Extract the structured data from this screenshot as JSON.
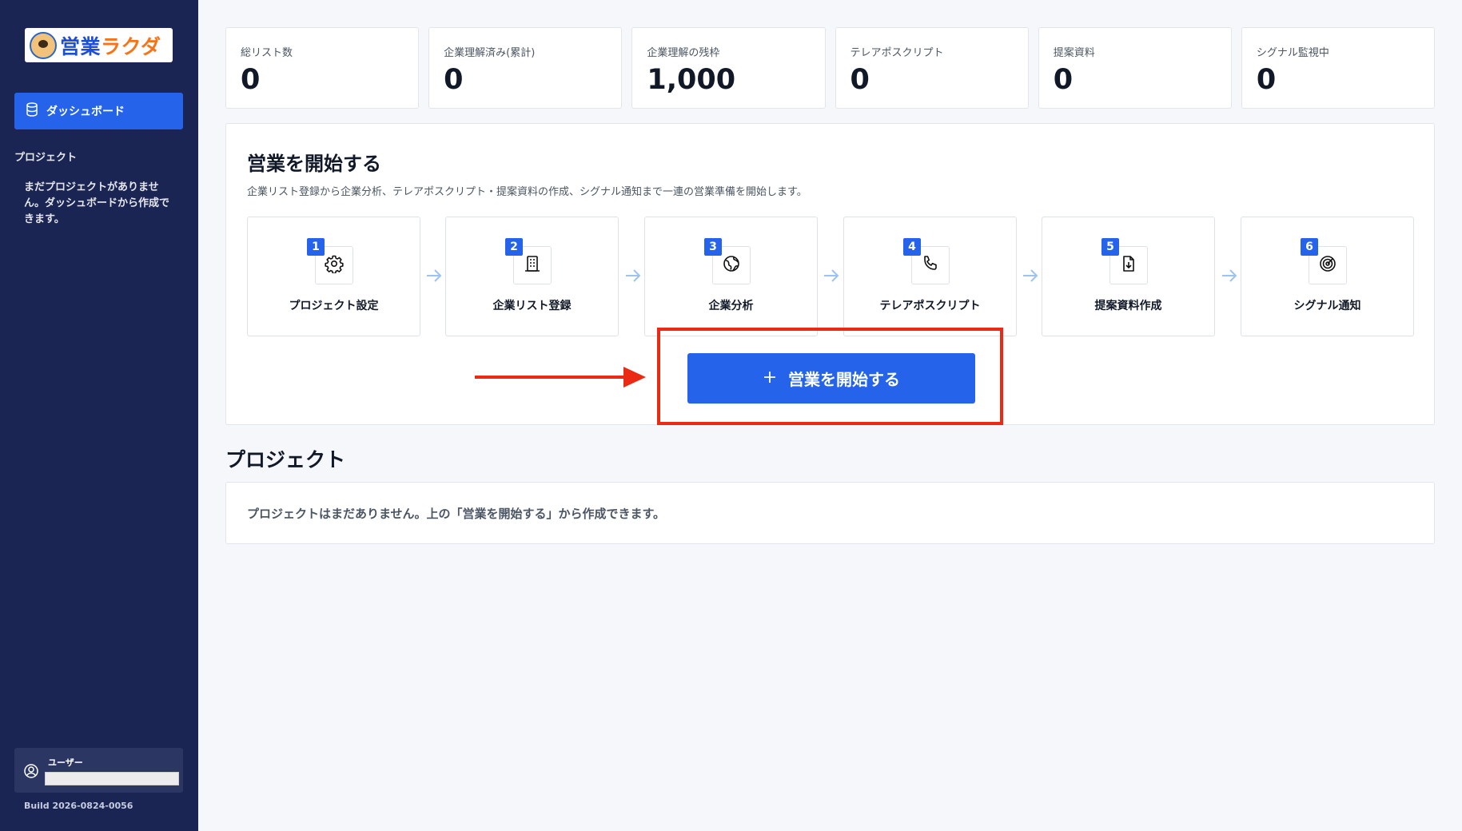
{
  "sidebar": {
    "logo": {
      "text_a": "営業",
      "text_b": "ラクダ"
    },
    "nav_dashboard": "ダッシュボード",
    "projects_section": "プロジェクト",
    "projects_empty": "まだプロジェクトがありません。ダッシュボードから作成できます。",
    "user_label": "ユーザー",
    "build": "Build 2026-0824-0056"
  },
  "stats": [
    {
      "label": "総リスト数",
      "value": "0"
    },
    {
      "label": "企業理解済み(累計)",
      "value": "0"
    },
    {
      "label": "企業理解の残枠",
      "value": "1,000"
    },
    {
      "label": "テレアポスクリプト",
      "value": "0"
    },
    {
      "label": "提案資料",
      "value": "0"
    },
    {
      "label": "シグナル監視中",
      "value": "0"
    }
  ],
  "start_panel": {
    "title": "営業を開始する",
    "description": "企業リスト登録から企業分析、テレアポスクリプト・提案資料の作成、シグナル通知まで一連の営業準備を開始します。",
    "steps": [
      {
        "num": "1",
        "label": "プロジェクト設定",
        "icon": "gear-icon"
      },
      {
        "num": "2",
        "label": "企業リスト登録",
        "icon": "building-icon"
      },
      {
        "num": "3",
        "label": "企業分析",
        "icon": "globe-icon"
      },
      {
        "num": "4",
        "label": "テレアポスクリプト",
        "icon": "phone-icon"
      },
      {
        "num": "5",
        "label": "提案資料作成",
        "icon": "file-download-icon"
      },
      {
        "num": "6",
        "label": "シグナル通知",
        "icon": "radar-icon"
      }
    ],
    "start_button": "営業を開始する"
  },
  "projects": {
    "title": "プロジェクト",
    "empty_message": "プロジェクトはまだありません。上の「営業を開始する」から作成できます。"
  },
  "colors": {
    "sidebar_bg": "#1a2554",
    "accent": "#2563eb",
    "highlight": "#ea2a12"
  }
}
